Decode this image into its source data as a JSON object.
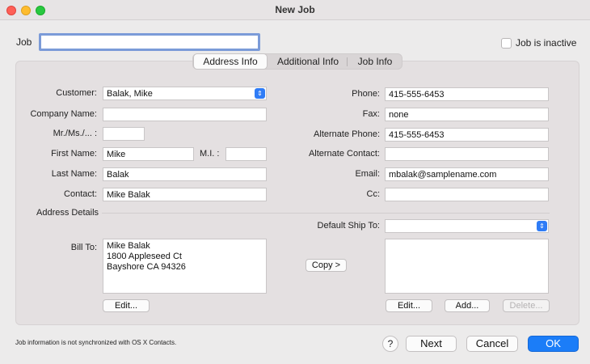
{
  "window": {
    "title": "New Job"
  },
  "job": {
    "label": "Job",
    "value": "",
    "inactive_label": "Job is inactive"
  },
  "tabs": [
    {
      "label": "Address Info"
    },
    {
      "label": "Additional Info"
    },
    {
      "label": "Job Info"
    }
  ],
  "form": {
    "customer_label": "Customer:",
    "customer_value": "Balak, Mike",
    "company_label": "Company Name:",
    "company_value": "",
    "mr_label": "Mr./Ms./... :",
    "mr_value": "",
    "first_label": "First Name:",
    "first_value": "Mike",
    "mi_label": "M.I. :",
    "mi_value": "",
    "last_label": "Last Name:",
    "last_value": "Balak",
    "contact_label": "Contact:",
    "contact_value": "Mike Balak",
    "phone_label": "Phone:",
    "phone_value": "415-555-6453",
    "fax_label": "Fax:",
    "fax_value": "none",
    "alt_phone_label": "Alternate Phone:",
    "alt_phone_value": "415-555-6453",
    "alt_contact_label": "Alternate Contact:",
    "alt_contact_value": "",
    "email_label": "Email:",
    "email_value": "mbalak@samplename.com",
    "cc_label": "Cc:",
    "cc_value": ""
  },
  "address": {
    "section_label": "Address Details",
    "bill_to_label": "Bill To:",
    "bill_to_lines": [
      "Mike Balak",
      "1800 Appleseed Ct",
      "Bayshore CA 94326"
    ],
    "ship_to_label": "Default Ship To:",
    "ship_to_value": "",
    "copy_button": "Copy >",
    "edit_bill_button": "Edit...",
    "edit_ship_button": "Edit...",
    "add_button": "Add...",
    "delete_button": "Delete..."
  },
  "footer": {
    "note": "Job information is not synchronized with OS X Contacts.",
    "help": "?",
    "next": "Next",
    "cancel": "Cancel",
    "ok": "OK"
  },
  "colors": {
    "accent": "#1b7df8",
    "focus_ring": "#7b9bd8"
  }
}
